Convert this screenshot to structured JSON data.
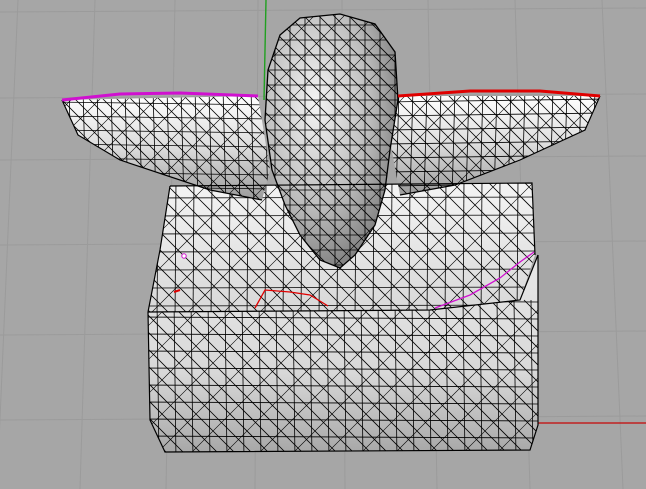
{
  "viewport": {
    "background": "#a6a6a6",
    "grid_color": "#9b9b9b",
    "grid_major_color": "#939393",
    "axis_x_color": "#c02020",
    "axis_y_color": "#20a020"
  },
  "mesh": {
    "fill_light": "#f2f2f2",
    "fill_mid": "#d2d2d2",
    "fill_dark": "#8e8e8e",
    "wire_color": "#000000",
    "naked_edge_left_color": "#d010d0",
    "naked_edge_right_color": "#e00000"
  }
}
